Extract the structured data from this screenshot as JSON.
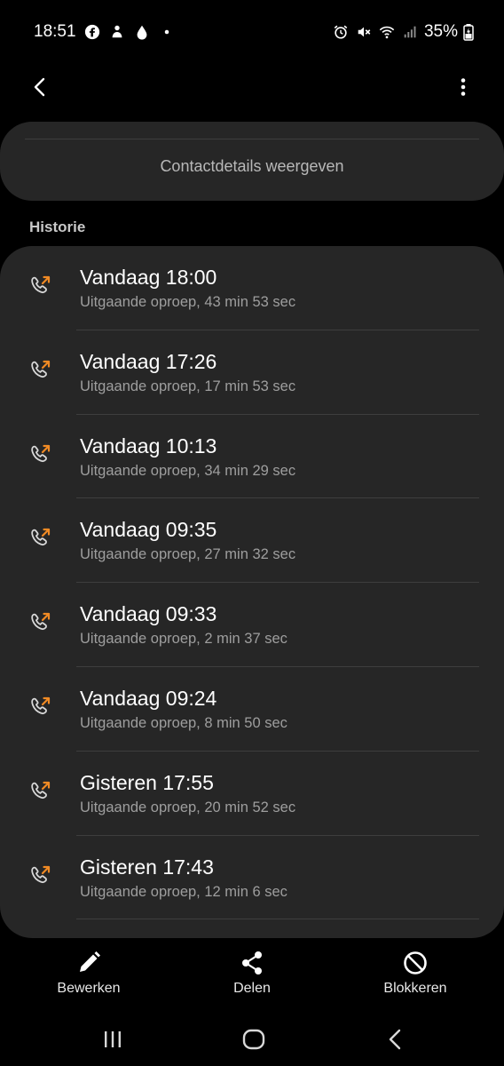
{
  "status_bar": {
    "time": "18:51",
    "battery": "35%",
    "left_icons": [
      "facebook-icon",
      "notification-icon",
      "drop-icon",
      "dot-icon"
    ],
    "right_icons": [
      "alarm-icon",
      "mute-icon",
      "wifi-icon",
      "signal-icon",
      "battery-icon"
    ]
  },
  "contact": {
    "details_label": "Contactdetails weergeven"
  },
  "history": {
    "title": "Historie",
    "items": [
      {
        "time": "Vandaag 18:00",
        "detail": "Uitgaande oproep, 43 min 53 sec"
      },
      {
        "time": "Vandaag 17:26",
        "detail": "Uitgaande oproep, 17 min 53 sec"
      },
      {
        "time": "Vandaag 10:13",
        "detail": "Uitgaande oproep, 34 min 29 sec"
      },
      {
        "time": "Vandaag 09:35",
        "detail": "Uitgaande oproep, 27 min 32 sec"
      },
      {
        "time": "Vandaag 09:33",
        "detail": "Uitgaande oproep, 2 min 37 sec"
      },
      {
        "time": "Vandaag 09:24",
        "detail": "Uitgaande oproep, 8 min 50 sec"
      },
      {
        "time": "Gisteren 17:55",
        "detail": "Uitgaande oproep, 20 min 52 sec"
      },
      {
        "time": "Gisteren 17:43",
        "detail": "Uitgaande oproep, 12 min 6 sec"
      }
    ]
  },
  "actions": {
    "edit_label": "Bewerken",
    "share_label": "Delen",
    "block_label": "Blokkeren"
  },
  "colors": {
    "background": "#000000",
    "card": "#262626",
    "outgoing_arrow": "#f08a24"
  }
}
